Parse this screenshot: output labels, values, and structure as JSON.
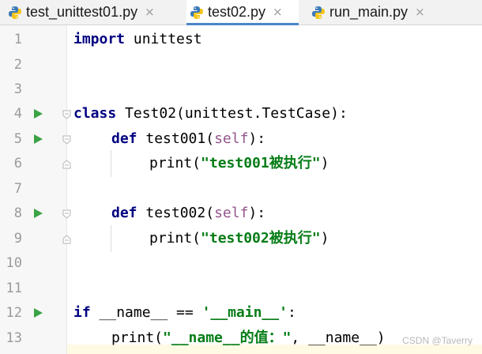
{
  "tabs": [
    {
      "label": "test_unittest01.py",
      "close": "×",
      "active": false
    },
    {
      "label": "test02.py",
      "close": "×",
      "active": true
    },
    {
      "label": "run_main.py",
      "close": "×",
      "active": false
    }
  ],
  "line_numbers": [
    "1",
    "2",
    "3",
    "4",
    "5",
    "6",
    "7",
    "8",
    "9",
    "10",
    "11",
    "12",
    "13"
  ],
  "code": {
    "l1_kw": "import",
    "l1_rest": " unittest",
    "l4_kw": "class",
    "l4_rest": " Test02(unittest.TestCase):",
    "l5_kw": "def",
    "l5_name": " test001(",
    "l5_self": "self",
    "l5_end": "):",
    "l6_fn": "print(",
    "l6_str": "\"test001被执行\"",
    "l6_end": ")",
    "l8_kw": "def",
    "l8_name": " test002(",
    "l8_self": "self",
    "l8_end": "):",
    "l9_fn": "print(",
    "l9_str": "\"test002被执行\"",
    "l9_end": ")",
    "l12_kw": "if",
    "l12_mid": " __name__ == ",
    "l12_str": "'__main__'",
    "l12_end": ":",
    "l13_fn": "print(",
    "l13_str": "\"__name__的值：\"",
    "l13_end": ", __name__)"
  },
  "watermark": "CSDN @Taverry",
  "colors": {
    "keyword": "#000080",
    "string": "#067d17",
    "self": "#94558d",
    "line_number": "#9a9a9a",
    "run_icon": "#3aa344",
    "active_tab_underline": "#4a86c8"
  },
  "icons": {
    "tab_file": "python-file-icon",
    "run": "run-triangle-icon",
    "fold_open": "fold-open-icon",
    "fold_end": "fold-end-icon"
  }
}
